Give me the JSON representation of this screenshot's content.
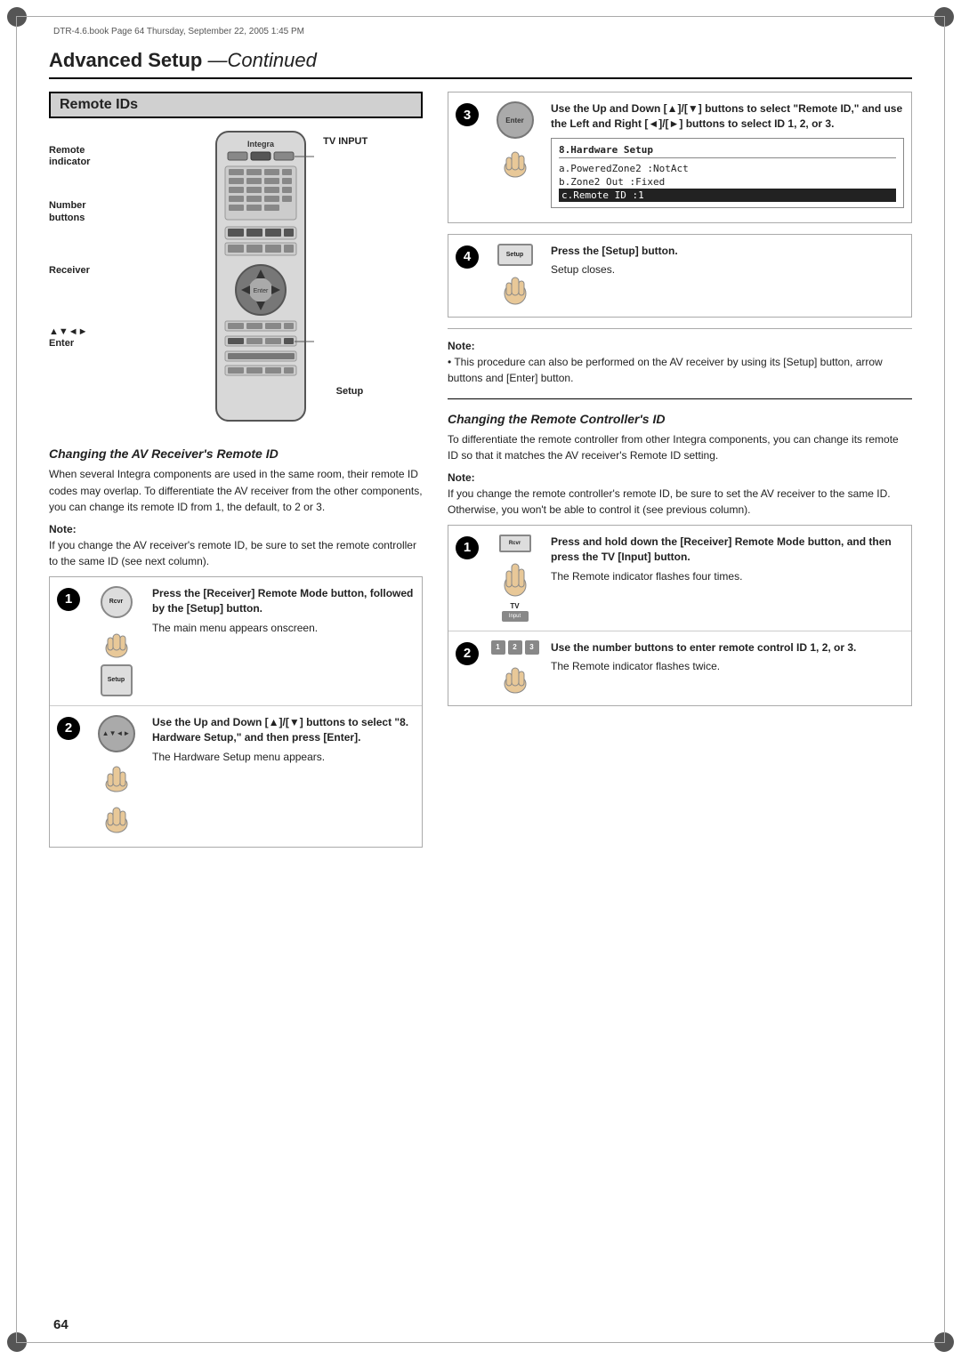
{
  "meta": {
    "header": "DTR-4.6.book  Page 64  Thursday, September 22, 2005  1:45 PM",
    "page_number": "64"
  },
  "page_title": "Advanced Setup",
  "page_title_suffix": "—Continued",
  "left_section": {
    "box_title": "Remote IDs",
    "diagram_labels": {
      "remote_indicator": "Remote\nindicator",
      "number_buttons": "Number\nbuttons",
      "receiver": "Receiver",
      "nav": "▲▼◄►\nEnter",
      "setup": "Setup",
      "tv_input": "TV INPUT"
    },
    "brand": "Integra",
    "subsection_title": "Changing the AV Receiver's Remote ID",
    "intro_text": "When several Integra components are used in the same room, their remote ID codes may overlap. To differentiate the AV receiver from the other components, you can change its remote ID from 1, the default, to 2 or 3.",
    "note_label": "Note:",
    "note_text": "If you change the AV receiver's remote ID, be sure to set the remote controller to the same ID (see next column).",
    "steps": [
      {
        "number": "1",
        "instruction": "Press the [Receiver] Remote Mode button, followed by the [Setup] button.",
        "description": "The main menu appears onscreen."
      },
      {
        "number": "2",
        "instruction": "Use the Up and Down [▲]/[▼] buttons to select \"8. Hardware Setup,\" and then press [Enter].",
        "description": "The Hardware Setup menu appears."
      }
    ]
  },
  "right_section": {
    "step3": {
      "number": "3",
      "instruction": "Use the Up and Down [▲]/[▼] buttons to select \"Remote ID,\" and use the Left and Right [◄]/[►] buttons to select ID 1, 2, or 3.",
      "osd": {
        "title": "8.Hardware Setup",
        "lines": [
          "a.PoweredZone2 :NotAct",
          "b.Zone2 Out :Fixed",
          "c.Remote ID      :1"
        ],
        "highlight_index": 2
      }
    },
    "step4": {
      "number": "4",
      "instruction": "Press the [Setup] button.",
      "description": "Setup closes."
    },
    "note_label": "Note:",
    "note_bullet": "This procedure can also be performed on the AV receiver by using its [Setup] button, arrow buttons and [Enter] button.",
    "right_subsection_title": "Changing the Remote Controller's ID",
    "right_intro": "To differentiate the remote controller from other Integra components, you can change its remote ID so that it matches the AV receiver's Remote ID setting.",
    "right_note_label": "Note:",
    "right_note_text": "If you change the remote controller's remote ID, be sure to set the AV receiver to the same ID. Otherwise, you won't be able to control it (see previous column).",
    "right_steps": [
      {
        "number": "1",
        "instruction": "Press and hold down the [Receiver] Remote Mode button, and then press the TV [Input] button.",
        "description": "The Remote indicator flashes four times."
      },
      {
        "number": "2",
        "instruction": "Use the number buttons to enter remote control ID 1, 2, or 3.",
        "description": "The Remote indicator flashes twice."
      }
    ]
  }
}
